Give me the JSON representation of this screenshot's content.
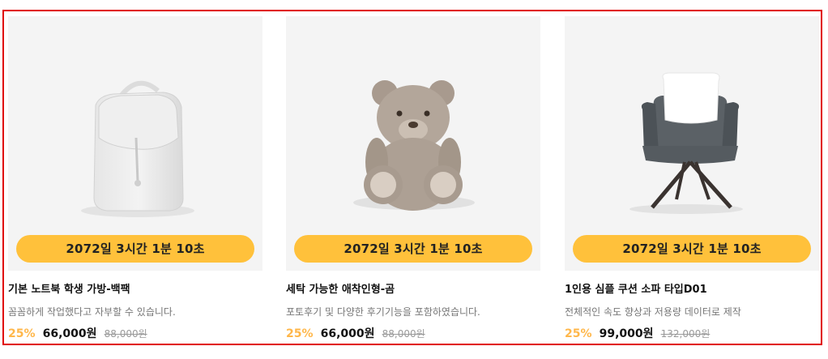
{
  "products": [
    {
      "image_icon": "backpack-image",
      "timer": "2072일 3시간 1분 10초",
      "title": "기본 노트북 학생 가방-백팩",
      "description": "꼼꼼하게 작업했다고 자부할 수 있습니다.",
      "discount": "25%",
      "price": "66,000원",
      "original_price": "88,000원"
    },
    {
      "image_icon": "teddy-bear-image",
      "timer": "2072일 3시간 1분 10초",
      "title": "세탁 가능한 애착인형-곰",
      "description": "포토후기 및 다양한 후기기능을 포함하였습니다.",
      "discount": "25%",
      "price": "66,000원",
      "original_price": "88,000원"
    },
    {
      "image_icon": "chair-image",
      "timer": "2072일 3시간 1분 10초",
      "title": "1인용 심플 쿠션 소파 타입D01",
      "description": "전체적인 속도 향상과 저용량 데이터로 제작",
      "discount": "25%",
      "price": "99,000원",
      "original_price": "132,000원"
    }
  ],
  "colors": {
    "timer_bg": "#ffc13b",
    "discount": "#ffb74a",
    "frame_border": "#e00000",
    "image_bg": "#f4f4f4"
  }
}
